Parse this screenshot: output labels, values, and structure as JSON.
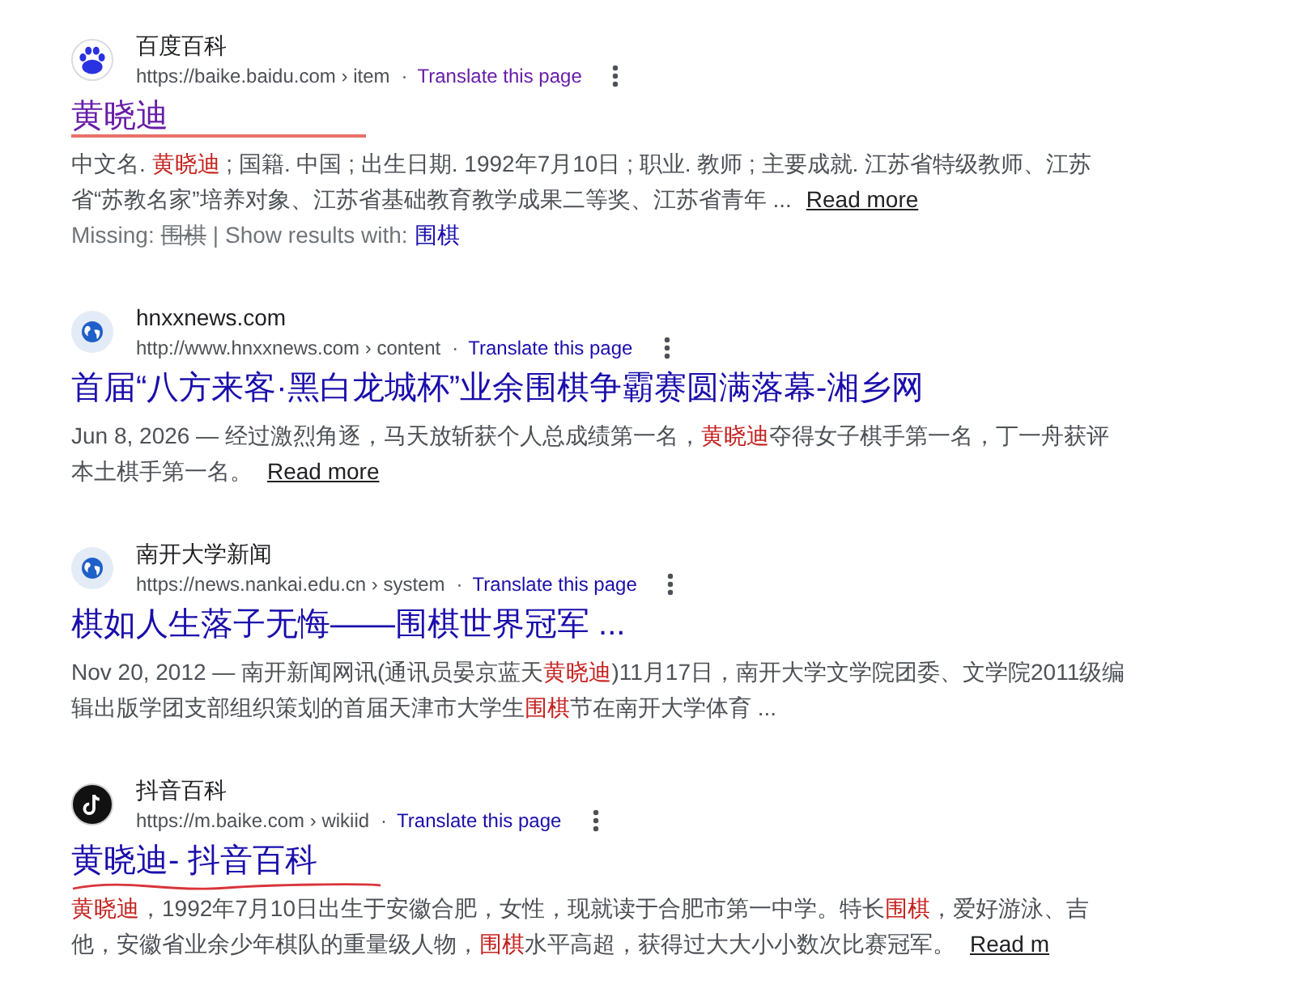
{
  "results": [
    {
      "favicon": {
        "kind": "paw"
      },
      "site_name": "百度百科",
      "url": "https://baike.baidu.com › item",
      "separator": "·",
      "translate": "Translate this page",
      "visited": true,
      "title": "黄晓迪",
      "annotation": {
        "kind": "line"
      },
      "snippet": [
        {
          "text": "中文名. ",
          "highlight": false
        },
        {
          "text": "黄晓迪",
          "highlight": true
        },
        {
          "text": " ; 国籍. 中国 ; 出生日期. 1992年7月10日 ; 职业. 教师 ; 主要成就. 江苏省特级教师、江苏省“苏教名家”培养对象、江苏省基础教育教学成果二等奖、江苏省青年 ...",
          "highlight": false
        }
      ],
      "read_more": "Read more",
      "missing": {
        "label": "Missing:",
        "term": "围棋",
        "separator": "|",
        "show_label": "Show results with:",
        "show_term": "围棋"
      }
    },
    {
      "favicon": {
        "kind": "globe"
      },
      "site_name": "hnxxnews.com",
      "url": "http://www.hnxxnews.com › content",
      "separator": "·",
      "translate": "Translate this page",
      "visited": false,
      "title": "首届“八方来客·黑白龙城杯”业余围棋争霸赛圆满落幕-湘乡网",
      "snippet": [
        {
          "text": "Jun 8, 2026 — 经过激烈角逐，马天放斩获个人总成绩第一名，",
          "highlight": false
        },
        {
          "text": "黄晓迪",
          "highlight": true
        },
        {
          "text": "夺得女子棋手第一名，丁一舟获评本土棋手第一名。",
          "highlight": false
        }
      ],
      "read_more": "Read more"
    },
    {
      "favicon": {
        "kind": "globe"
      },
      "site_name": "南开大学新闻",
      "url": "https://news.nankai.edu.cn › system",
      "separator": "·",
      "translate": "Translate this page",
      "visited": false,
      "title": "棋如人生落子无悔——围棋世界冠军 ...",
      "snippet": [
        {
          "text": "Nov 20, 2012 — 南开新闻网讯(通讯员晏京蓝天",
          "highlight": false
        },
        {
          "text": "黄晓迪",
          "highlight": true
        },
        {
          "text": ")11月17日，南开大学文学院团委、文学院2011级编辑出版学团支部组织策划的首届天津市大学生",
          "highlight": false
        },
        {
          "text": "围棋",
          "highlight": true
        },
        {
          "text": "节在南开大学体育 ...",
          "highlight": false
        }
      ]
    },
    {
      "favicon": {
        "kind": "note"
      },
      "site_name": "抖音百科",
      "url": "https://m.baike.com › wikiid",
      "separator": "·",
      "translate": "Translate this page",
      "visited": false,
      "title": "黄晓迪- 抖音百科",
      "annotation": {
        "kind": "wave"
      },
      "snippet": [
        {
          "text": "黄晓迪",
          "highlight": true
        },
        {
          "text": "，1992年7月10日出生于安徽合肥，女性，现就读于合肥市第一中学。特长",
          "highlight": false
        },
        {
          "text": "围棋",
          "highlight": true
        },
        {
          "text": "，爱好游泳、吉他，安徽省业余少年棋队的重量级人物，",
          "highlight": false
        },
        {
          "text": "围棋",
          "highlight": true
        },
        {
          "text": "水平高超，获得过大大小小数次比赛冠军。",
          "highlight": false
        }
      ],
      "read_more": "Read m"
    }
  ]
}
